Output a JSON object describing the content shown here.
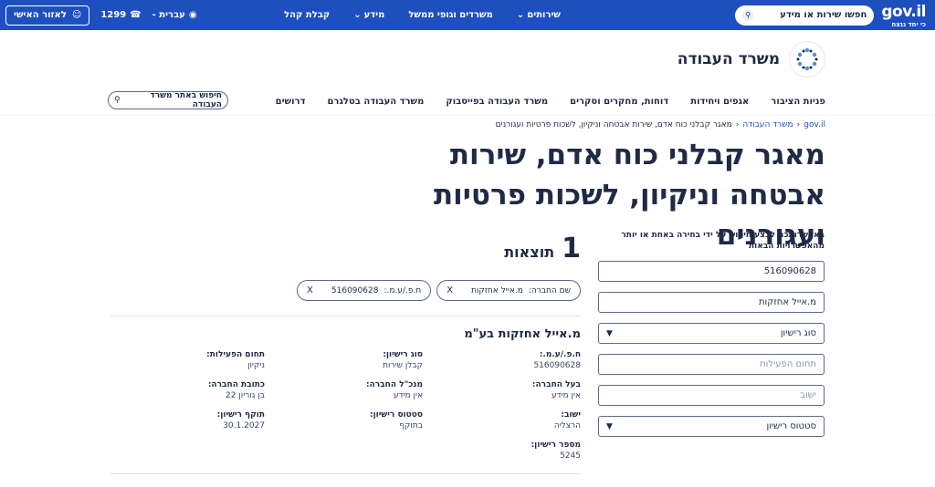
{
  "topbar": {
    "logo_text": "gov.il",
    "logo_sub": "כי יחד ננצח",
    "search_placeholder": "חפשו שירות או מידע",
    "nav": [
      "שירותים",
      "משרדים וגופי ממשל",
      "מידע",
      "קבלת קהל"
    ],
    "language": "עברית -",
    "phone": "1299",
    "personal_area": "לאזור האישי"
  },
  "ministry": {
    "name": "משרד העבודה",
    "subnav": [
      "פניות הציבור",
      "אגפים ויחידות",
      "דוחות, מחקרים וסקרים",
      "משרד העבודה בפייסבוק",
      "משרד העבודה בטלגרם",
      "דרושים"
    ],
    "site_search": "חיפוש באתר משרד העבודה"
  },
  "breadcrumb": {
    "home": "gov.il",
    "ministry": "משרד העבודה",
    "current": "מאגר קבלני כוח אדם, שירות אבטחה וניקיון, לשכות פרטיות ועגורנים"
  },
  "page_title": "מאגר קבלני כוח אדם, שירות אבטחה וניקיון, לשכות פרטיות ועגורנים",
  "filters": {
    "intro": "באפשרותכם לבצע חיפוש על ידי בחירה באחת או יותר מהאפשרויות הבאות",
    "company_id": "516090628",
    "company_name": "מ.אייל אחזקות",
    "license_type": "סוג רישיון",
    "activity_field": "תחום הפעילות",
    "settlement": "ישוב",
    "license_status": "סטטוס רישיון"
  },
  "results": {
    "count": "1",
    "label": "תוצאות",
    "chips": [
      {
        "label": "שם החברה:",
        "value": "מ.אייל אחזקות",
        "x": "X"
      },
      {
        "label": "ח.פ./ע.מ.:",
        "value": "516090628",
        "x": "X"
      }
    ],
    "company": "מ.אייל אחזקות בע\"מ",
    "fields": [
      {
        "k": "ח.פ./ע.מ.:",
        "v": "516090628"
      },
      {
        "k": "סוג רישיון:",
        "v": "קבלן שירות"
      },
      {
        "k": "תחום הפעילות:",
        "v": "ניקיון"
      },
      {
        "k": "בעל החברה:",
        "v": "אין מידע"
      },
      {
        "k": "מנכ\"ל החברה:",
        "v": "אין מידע"
      },
      {
        "k": "כתובת החברה:",
        "v": "בן גוריון 22"
      },
      {
        "k": "ישוב:",
        "v": "הרצליה"
      },
      {
        "k": "סטטוס רישיון:",
        "v": "בתוקף"
      },
      {
        "k": "תוקף רישיון:",
        "v": "30.1.2027"
      },
      {
        "k": "מספר רישיון:",
        "v": "5245"
      }
    ]
  }
}
